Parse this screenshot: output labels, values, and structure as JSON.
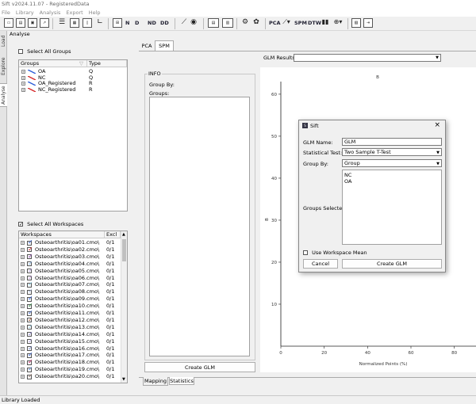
{
  "window": {
    "title": "Sift v2024.11.07 - RegisteredData"
  },
  "menu": [
    "File",
    "Library",
    "Analysis",
    "Export",
    "Help"
  ],
  "toolbar": {
    "pca": "PCA",
    "spm": "SPM",
    "dtw": "DTW",
    "nd": "ND",
    "dd": "DD"
  },
  "sidetabs": [
    "Load",
    "Explore",
    "Analyse"
  ],
  "panel": {
    "title": "Analyse"
  },
  "groups": {
    "select_all": "Select All Groups",
    "col_groups": "Groups",
    "col_type": "Type",
    "items": [
      {
        "name": "OA",
        "type": "Q",
        "color": "#2a5bd7"
      },
      {
        "name": "NC",
        "type": "Q",
        "color": "#d62728"
      },
      {
        "name": "OA_Registered",
        "type": "R",
        "color": "#2a5bd7"
      },
      {
        "name": "NC_Registered",
        "type": "R",
        "color": "#d62728"
      }
    ]
  },
  "workspaces": {
    "select_all": "Select All Workspaces",
    "col_ws": "Workspaces",
    "col_excl": "Excl",
    "items": [
      {
        "name": "Osteoarthritis\\oa01.cmo\\",
        "excl": "0/1",
        "color": "#2a5bd7"
      },
      {
        "name": "Osteoarthritis\\oa02.cmo\\",
        "excl": "0/1",
        "color": "#d62728"
      },
      {
        "name": "Osteoarthritis\\oa03.cmo\\",
        "excl": "0/1",
        "color": "#8e44ad"
      },
      {
        "name": "Osteoarthritis\\oa04.cmo\\",
        "excl": "0/1",
        "color": "#7fb3e8"
      },
      {
        "name": "Osteoarthritis\\oa05.cmo\\",
        "excl": "0/1",
        "color": "#b39ddb"
      },
      {
        "name": "Osteoarthritis\\oa06.cmo\\",
        "excl": "0/1",
        "color": "#c79ee0"
      },
      {
        "name": "Osteoarthritis\\oa07.cmo\\",
        "excl": "0/1",
        "color": "#7ec8e3"
      },
      {
        "name": "Osteoarthritis\\oa08.cmo\\",
        "excl": "0/1",
        "color": "#a5b4d8"
      },
      {
        "name": "Osteoarthritis\\oa09.cmo\\",
        "excl": "0/1",
        "color": "#2a5bd7"
      },
      {
        "name": "Osteoarthritis\\oa10.cmo\\",
        "excl": "0/1",
        "color": "#2a8a3a"
      },
      {
        "name": "Osteoarthritis\\oa11.cmo\\",
        "excl": "0/1",
        "color": "#3d6bd6"
      },
      {
        "name": "Osteoarthritis\\oa12.cmo\\",
        "excl": "0/1",
        "color": "#a0522d"
      },
      {
        "name": "Osteoarthritis\\oa13.cmo\\",
        "excl": "0/1",
        "color": "#9ad0ec"
      },
      {
        "name": "Osteoarthritis\\oa14.cmo\\",
        "excl": "0/1",
        "color": "#8f86d6"
      },
      {
        "name": "Osteoarthritis\\oa15.cmo\\",
        "excl": "0/1",
        "color": "#b7a4e0"
      },
      {
        "name": "Osteoarthritis\\oa16.cmo\\",
        "excl": "0/1",
        "color": "#7a8fd0"
      },
      {
        "name": "Osteoarthritis\\oa17.cmo\\",
        "excl": "0/1",
        "color": "#2a5bd7"
      },
      {
        "name": "Osteoarthritis\\oa18.cmo\\",
        "excl": "0/1",
        "color": "#c2185b"
      },
      {
        "name": "Osteoarthritis\\oa19.cmo\\",
        "excl": "0/1",
        "color": "#5e8fd9"
      },
      {
        "name": "Osteoarthritis\\oa20.cmo\\",
        "excl": "0/1",
        "color": "#8d6e63"
      }
    ]
  },
  "tabs": {
    "pca": "PCA",
    "spm": "SPM"
  },
  "glm_results_label": "GLM Results:",
  "info": {
    "title": "INFO",
    "group_by": "Group By:",
    "groups": "Groups:",
    "create_glm": "Create GLM"
  },
  "bottom_tabs": {
    "mapping": "Mapping",
    "statistics": "Statistics"
  },
  "chart_data": {
    "type": "line",
    "title": "B",
    "xlabel": "Normalized Points (%)",
    "ylabel": "B",
    "xlim": [
      0,
      90
    ],
    "ylim": [
      0,
      63
    ],
    "xticks": [
      0,
      20,
      40,
      60,
      80
    ],
    "yticks": [
      10,
      20,
      30,
      40,
      50,
      60
    ],
    "series": []
  },
  "dialog": {
    "title": "Sift",
    "glm_name_label": "GLM Name:",
    "glm_name_value": "GLM",
    "stat_test_label": "Statistical Test:",
    "stat_test_value": "Two Sample T-Test",
    "group_by_label": "Group By:",
    "group_by_value": "Group",
    "groups_selected_label": "Groups Selected:",
    "groups_selected": [
      "NC",
      "OA"
    ],
    "use_ws_mean": "Use Workspace Mean",
    "cancel": "Cancel",
    "create": "Create GLM"
  },
  "status": "Library Loaded"
}
